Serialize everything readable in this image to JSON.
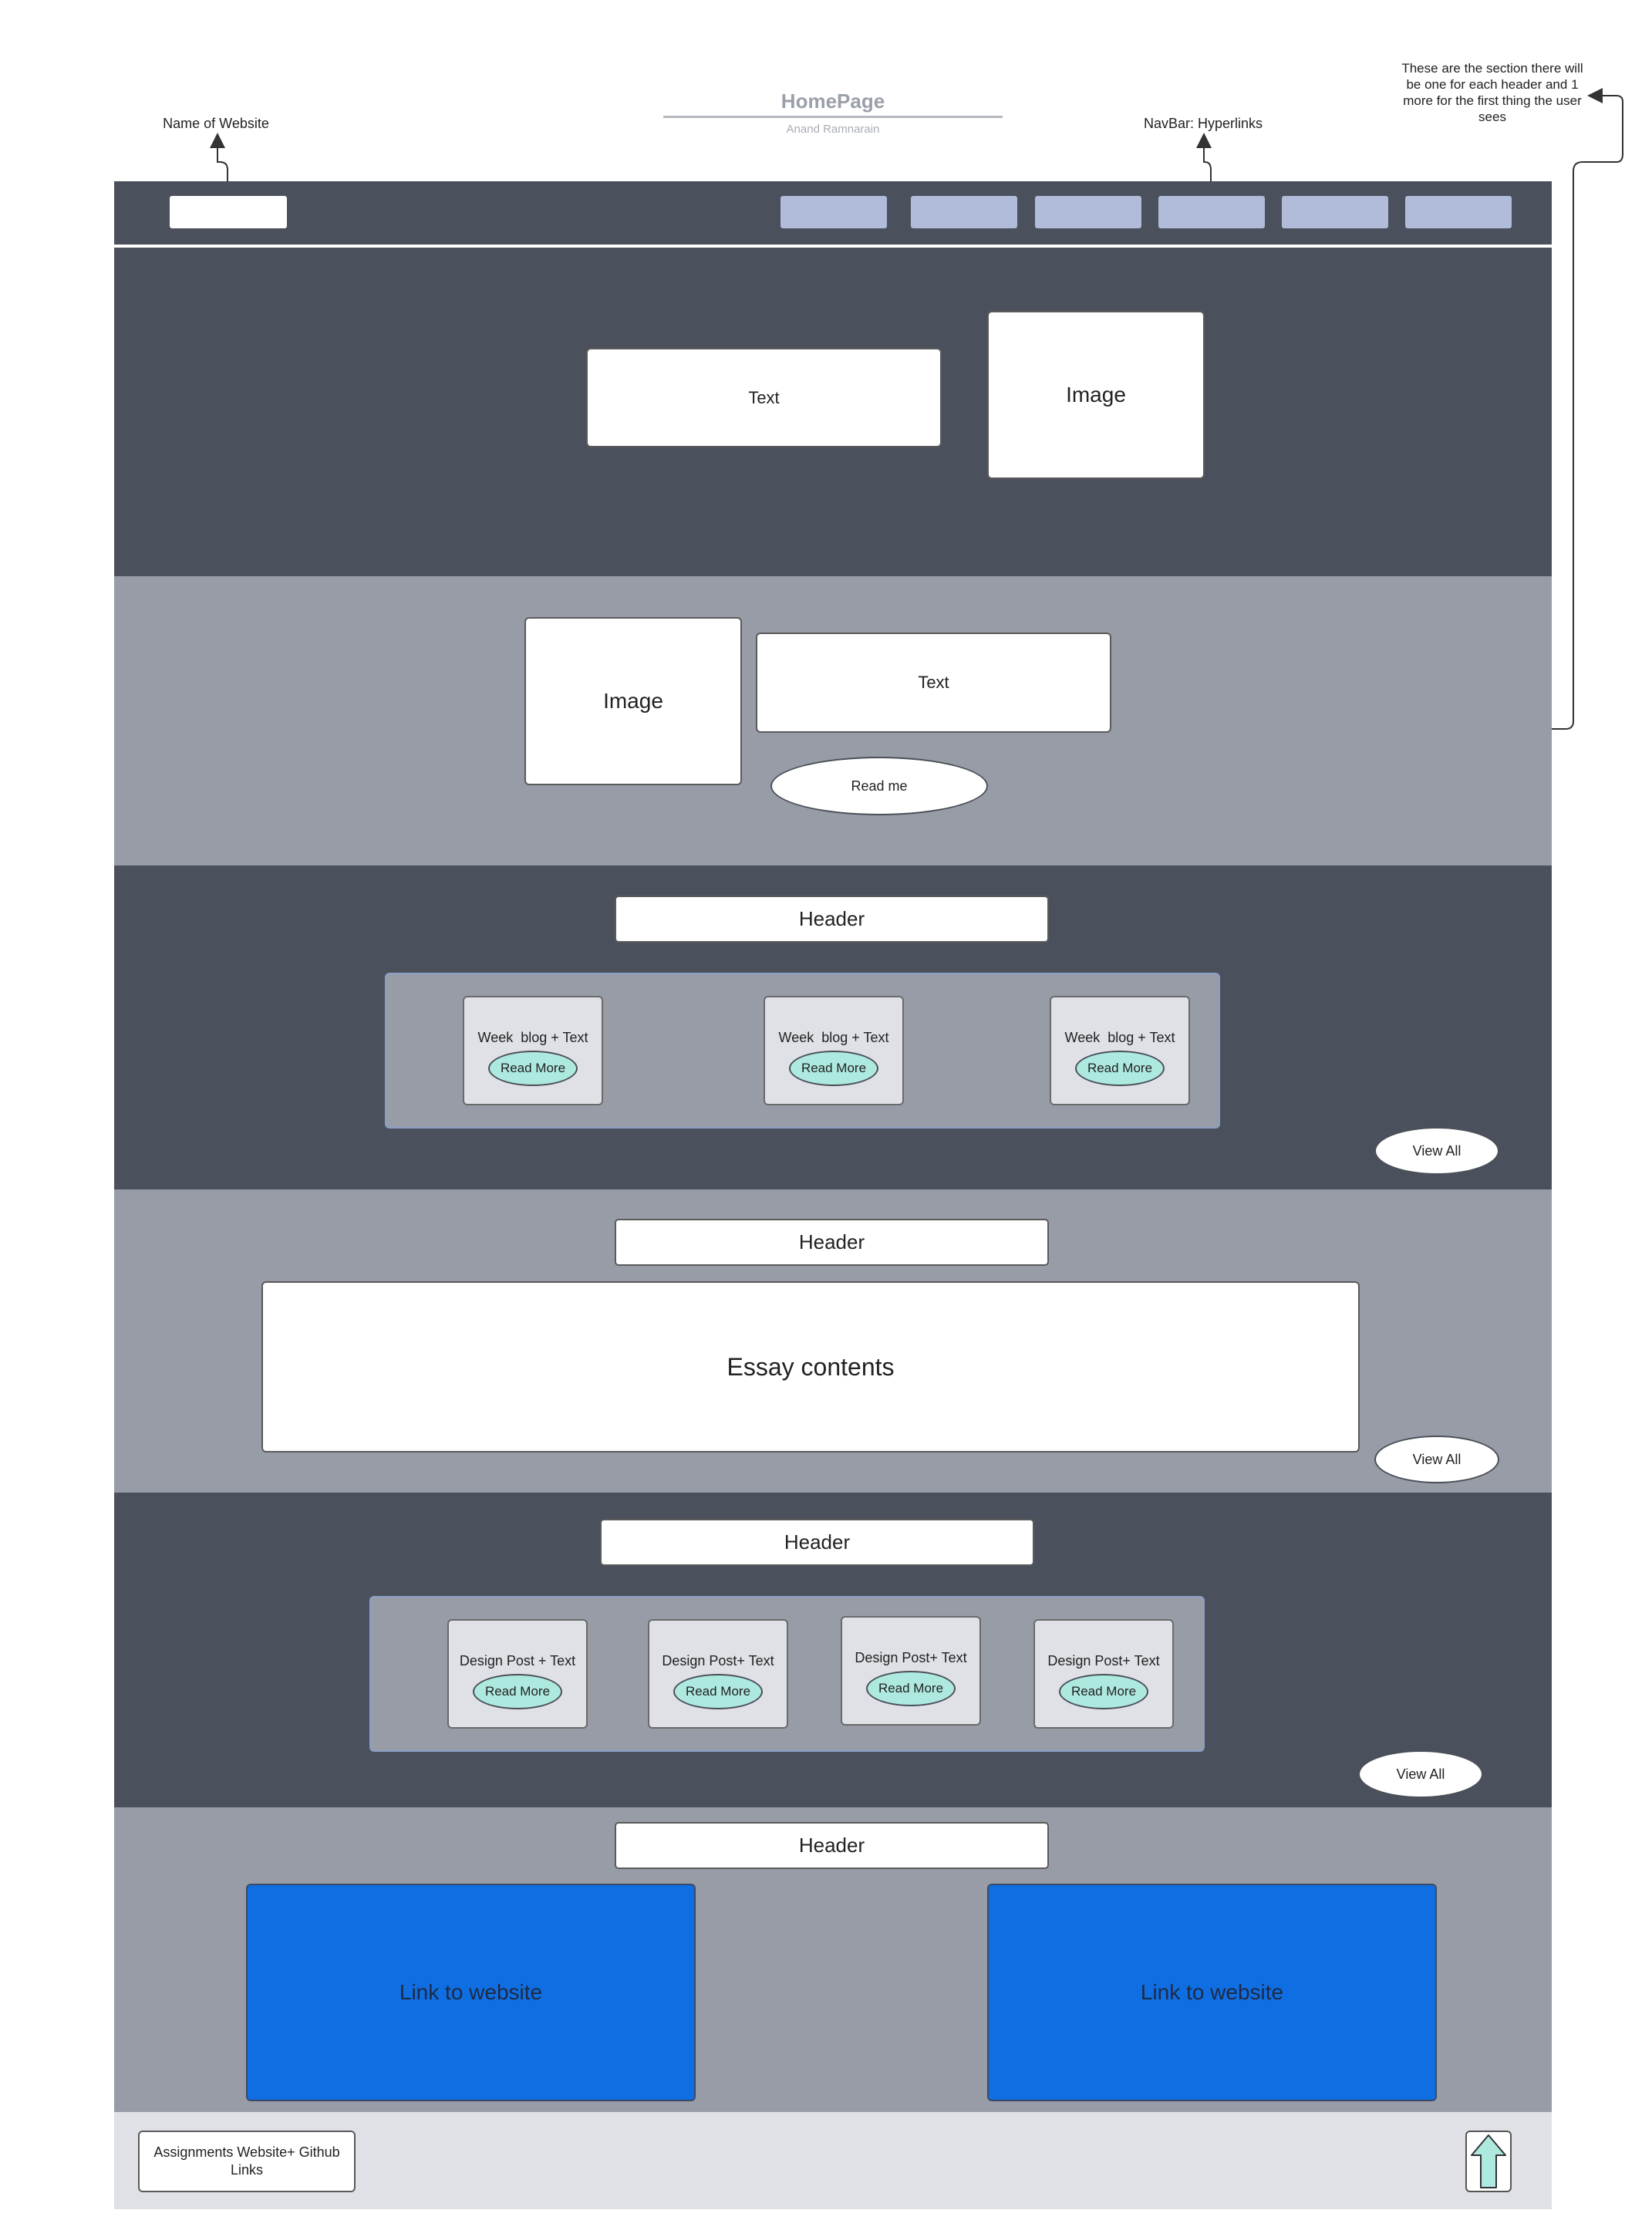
{
  "title": "HomePage",
  "author": "Anand Ramnarain",
  "annotations": {
    "name_of_website": "Name of Website",
    "navbar": "NavBar: Hyperlinks",
    "sections_note": "These are the section there will be one for each header and 1 more for the first thing the user sees"
  },
  "hero": {
    "text": "Text",
    "image": "Image"
  },
  "about": {
    "image": "Image",
    "text": "Text",
    "button": "Read me"
  },
  "blog_section": {
    "header": "Header",
    "cards": [
      {
        "label": "Week  blog + Text",
        "button": "Read More"
      },
      {
        "label": "Week  blog + Text",
        "button": "Read More"
      },
      {
        "label": "Week  blog + Text",
        "button": "Read More"
      }
    ],
    "view_all": "View All"
  },
  "essay_section": {
    "header": "Header",
    "content": "Essay contents",
    "view_all": "View All"
  },
  "design_section": {
    "header": "Header",
    "cards": [
      {
        "label": "Design Post + Text",
        "button": "Read More"
      },
      {
        "label": "Design Post+ Text",
        "button": "Read More"
      },
      {
        "label": "Design Post+ Text",
        "button": "Read More"
      },
      {
        "label": "Design Post+ Text",
        "button": "Read More"
      }
    ],
    "view_all": "View All"
  },
  "links_section": {
    "header": "Header",
    "links": [
      "Link to website",
      "Link to website"
    ]
  },
  "footer": {
    "label": "Assignments Website+ Github Links",
    "up_icon": "up-arrow-icon"
  },
  "colors": {
    "dark": "#4b515c",
    "mid": "#979ca6",
    "nav_button": "#b0bcd9",
    "teal": "#aee9e0",
    "link_blue": "#0f6ee2",
    "footer": "#dfe1e6"
  }
}
